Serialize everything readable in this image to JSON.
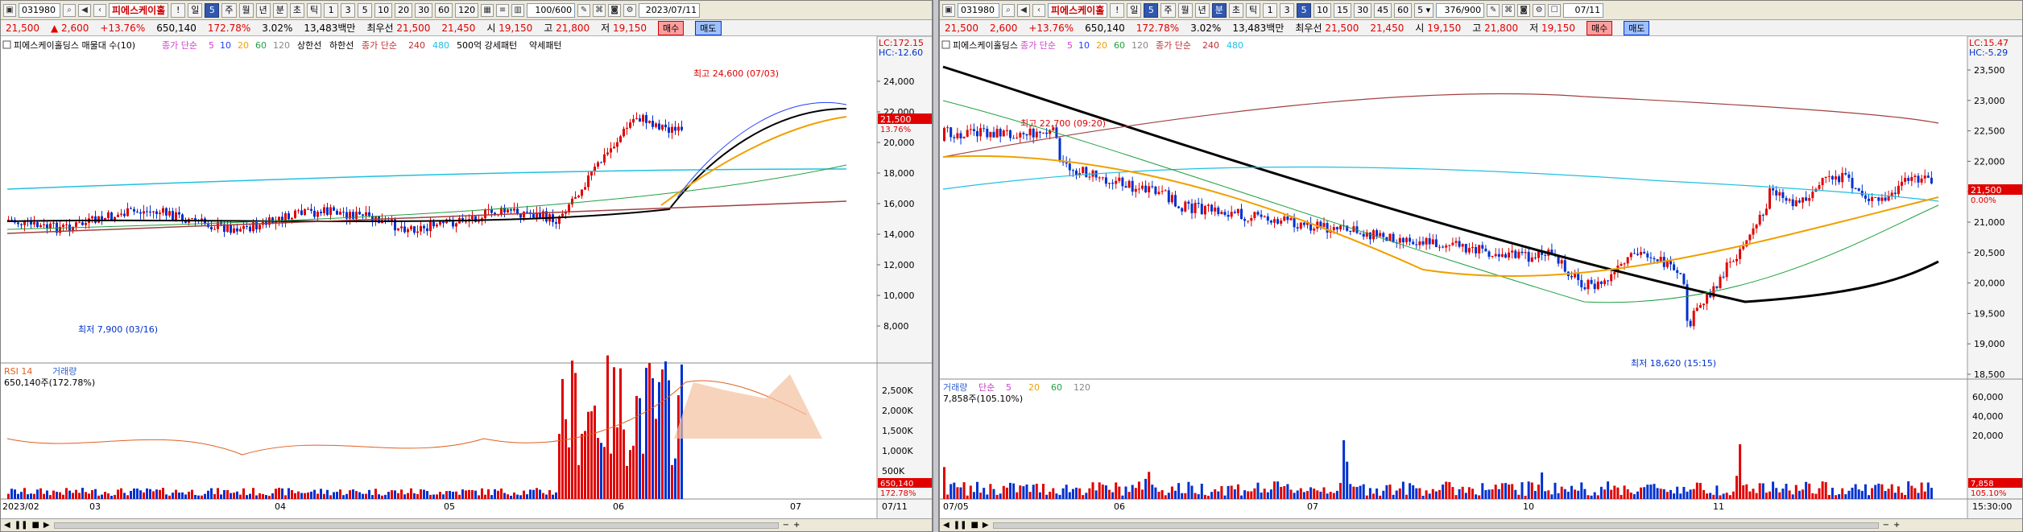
{
  "left": {
    "toolbar": {
      "code": "031980",
      "name": "피에스케이홀",
      "bang": "!",
      "interval": "5",
      "periods": [
        "주",
        "월",
        "년",
        "분",
        "초",
        "틱"
      ],
      "mins": [
        "1",
        "3",
        "5",
        "10",
        "20",
        "30",
        "60",
        "120"
      ],
      "count": "100/600",
      "date": "2023/07/11"
    },
    "quote": {
      "price": "21,500",
      "change": "▲ 2,600",
      "pct": "+13.76%",
      "volume": "650,140",
      "vol_ratio": "172.78%",
      "turnover": "3.02%",
      "amount": "13,483백만",
      "best_ask_label": "최우선",
      "best_ask": "21,500",
      "best_bid": "21,450",
      "open_label": "시",
      "open": "19,150",
      "high_label": "고",
      "high": "21,800",
      "low_label": "저",
      "low": "19,150",
      "buy": "매수",
      "sell": "매도"
    },
    "legend": {
      "title": "피에스케이홀딩스 매물대 수(10)",
      "ma_label": "종가 단순",
      "ma": [
        "5",
        "10",
        "20",
        "60",
        "120"
      ],
      "limit": [
        "상한선",
        "하한선"
      ],
      "ma2_label": "종가 단순",
      "ma2": [
        "240",
        "480"
      ],
      "pattern": [
        "500억 강세패턴",
        "약세패턴"
      ]
    },
    "price_axis": [
      "24,000",
      "22,000",
      "20,000",
      "18,000",
      "16,000",
      "14,000",
      "12,000",
      "10,000",
      "8,000"
    ],
    "lc": "LC:172.15",
    "hc": "HC:-12.60",
    "last_price": "21,500",
    "last_pct": "13.76%",
    "high_anno": "최고 24,600 (07/03)",
    "low_anno": "최저 7,900 (03/16)",
    "sub_legend": {
      "rsi": "RSI 14",
      "vol": "거래량",
      "vol_value": "650,140주(172.78%)"
    },
    "vol_axis": [
      "2,500K",
      "2,000K",
      "1,500K",
      "1,000K",
      "500K"
    ],
    "vol_last": "650,140",
    "vol_last_pct": "172.78%",
    "dates": [
      "2023/02",
      "03",
      "04",
      "05",
      "06",
      "07",
      "07/11"
    ]
  },
  "right": {
    "toolbar": {
      "code": "031980",
      "name": "피에스케이홀",
      "bang": "!",
      "interval": "5",
      "periods": [
        "주",
        "월",
        "년",
        "분",
        "초",
        "틱"
      ],
      "mins": [
        "1",
        "3",
        "5",
        "10",
        "15",
        "30",
        "45",
        "60"
      ],
      "count": "376/900",
      "date": "07/11"
    },
    "quote": {
      "price": "21,500",
      "change": "2,600",
      "pct": "+13.76%",
      "volume": "650,140",
      "vol_ratio": "172.78%",
      "turnover": "3.02%",
      "amount": "13,483백만",
      "best_ask_label": "최우선",
      "best_ask": "21,500",
      "best_bid": "21,450",
      "open_label": "시",
      "open": "19,150",
      "high_label": "고",
      "high": "21,800",
      "low_label": "저",
      "low": "19,150",
      "buy": "매수",
      "sell": "매도"
    },
    "legend": {
      "title": "피에스케이홀딩스",
      "ma_label": "종가 단순",
      "ma": [
        "5",
        "10",
        "20",
        "60",
        "120"
      ],
      "ma2_label": "종가 단순",
      "ma2": [
        "240",
        "480"
      ]
    },
    "price_axis": [
      "23,500",
      "23,000",
      "22,500",
      "22,000",
      "21,500",
      "21,000",
      "20,500",
      "20,000",
      "19,500",
      "19,000",
      "18,500"
    ],
    "lc": "LC:15.47",
    "hc": "HC:-5.29",
    "last_price": "21,500",
    "last_pct": "0.00%",
    "high_anno": "최고 22,700 (09:20)",
    "low_anno": "최저 18,620 (15:15)",
    "sub_legend": {
      "vol": "거래량",
      "ma_label": "단순",
      "ma": [
        "5",
        "20",
        "60",
        "120"
      ],
      "vol_value": "7,858주(105.10%)"
    },
    "vol_axis": [
      "60,000",
      "40,000",
      "20,000"
    ],
    "vol_last": "7,858",
    "vol_last_pct": "105.10%",
    "dates": [
      "07/05",
      "06",
      "07",
      "10",
      "11",
      "15:30:00"
    ]
  },
  "colors": {
    "up": "#e00000",
    "down": "#0030d0",
    "ma5": "#d040d0",
    "ma10": "#2040ff",
    "ma20": "#f0a000",
    "ma60": "#20a040",
    "ma120": "#888888",
    "ma240": "#000000",
    "ma480": "#20c0e0",
    "pink": "#f8a0d0",
    "gold": "#f0c000"
  }
}
